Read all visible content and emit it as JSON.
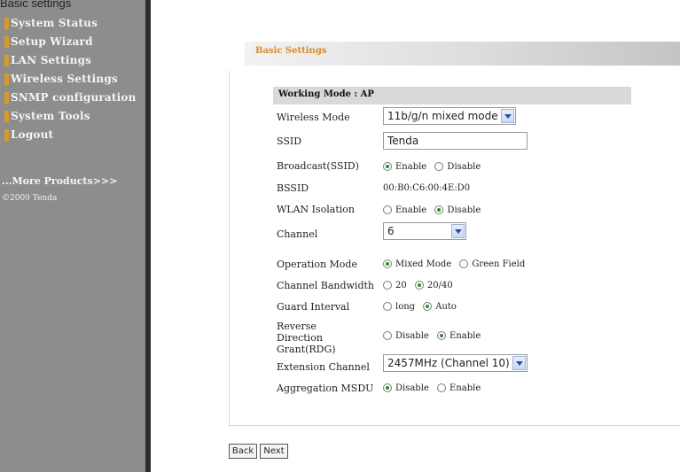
{
  "top_caption": "Basic settings",
  "sidebar": {
    "items": [
      {
        "label": "System Status"
      },
      {
        "label": "Setup Wizard"
      },
      {
        "label": "LAN Settings"
      },
      {
        "label": "Wireless Settings"
      },
      {
        "label": "SNMP configuration"
      },
      {
        "label": "System Tools"
      },
      {
        "label": "Logout"
      }
    ],
    "more_products": "...More Products>>>",
    "copyright": "©2009 Tenda"
  },
  "panel": {
    "title": "Basic Settings",
    "section_title": "Working Mode : AP"
  },
  "form": {
    "wireless_mode": {
      "label": "Wireless Mode",
      "value": "11b/g/n mixed mode"
    },
    "ssid": {
      "label": "SSID",
      "value": "Tenda"
    },
    "broadcast": {
      "label": "Broadcast(SSID)",
      "options": [
        "Enable",
        "Disable"
      ],
      "selected": "Enable"
    },
    "bssid": {
      "label": "BSSID",
      "value": "00:B0:C6:00:4E:D0"
    },
    "wlan_isolation": {
      "label": "WLAN Isolation",
      "options": [
        "Enable",
        "Disable"
      ],
      "selected": "Disable"
    },
    "channel": {
      "label": "Channel",
      "value": "6"
    },
    "operation_mode": {
      "label": "Operation Mode",
      "options": [
        "Mixed Mode",
        "Green Field"
      ],
      "selected": "Mixed Mode"
    },
    "channel_bandwidth": {
      "label": "Channel Bandwidth",
      "options": [
        "20",
        "20/40"
      ],
      "selected": "20/40"
    },
    "guard_interval": {
      "label": "Guard Interval",
      "options": [
        "long",
        "Auto"
      ],
      "selected": "Auto"
    },
    "rdg": {
      "label": "Reverse Direction Grant(RDG)",
      "options": [
        "Disable",
        "Enable"
      ],
      "selected": "Enable"
    },
    "extension_channel": {
      "label": "Extension Channel",
      "value": "2457MHz (Channel 10)"
    },
    "aggregation_msdu": {
      "label": "Aggregation MSDU",
      "options": [
        "Disable",
        "Enable"
      ],
      "selected": "Disable"
    }
  },
  "buttons": {
    "back": "Back",
    "next": "Next"
  },
  "colors": {
    "sidebar_bg": "#8d8d8d",
    "nav_marker": "#d89a2a",
    "title_accent": "#d58a2a",
    "radio_checked": "#2e8b2e"
  }
}
